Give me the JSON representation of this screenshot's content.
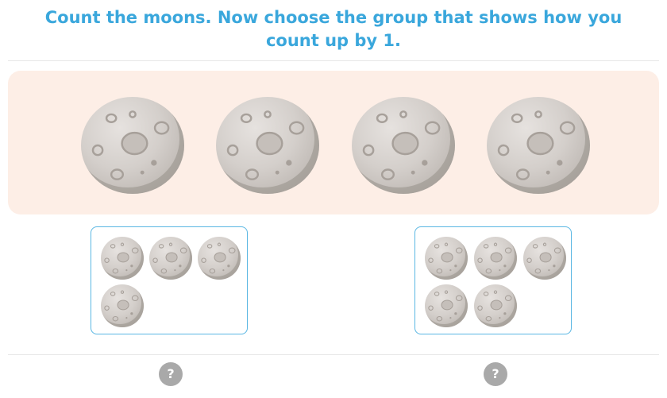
{
  "question": {
    "text": "Count the moons. Now choose the group that shows how you count up by 1."
  },
  "prompt_group": {
    "moon_count": 4,
    "icon": "moon-icon"
  },
  "answer_choices": [
    {
      "moon_count": 4,
      "icon": "moon-icon"
    },
    {
      "moon_count": 5,
      "icon": "moon-icon"
    }
  ],
  "hint_buttons": [
    {
      "label": "?"
    },
    {
      "label": "?"
    }
  ],
  "colors": {
    "question_text": "#3aa7dc",
    "panel_background": "#fdeee6",
    "choice_border": "#5ab7e3",
    "hint_background": "#a9a9a9"
  }
}
